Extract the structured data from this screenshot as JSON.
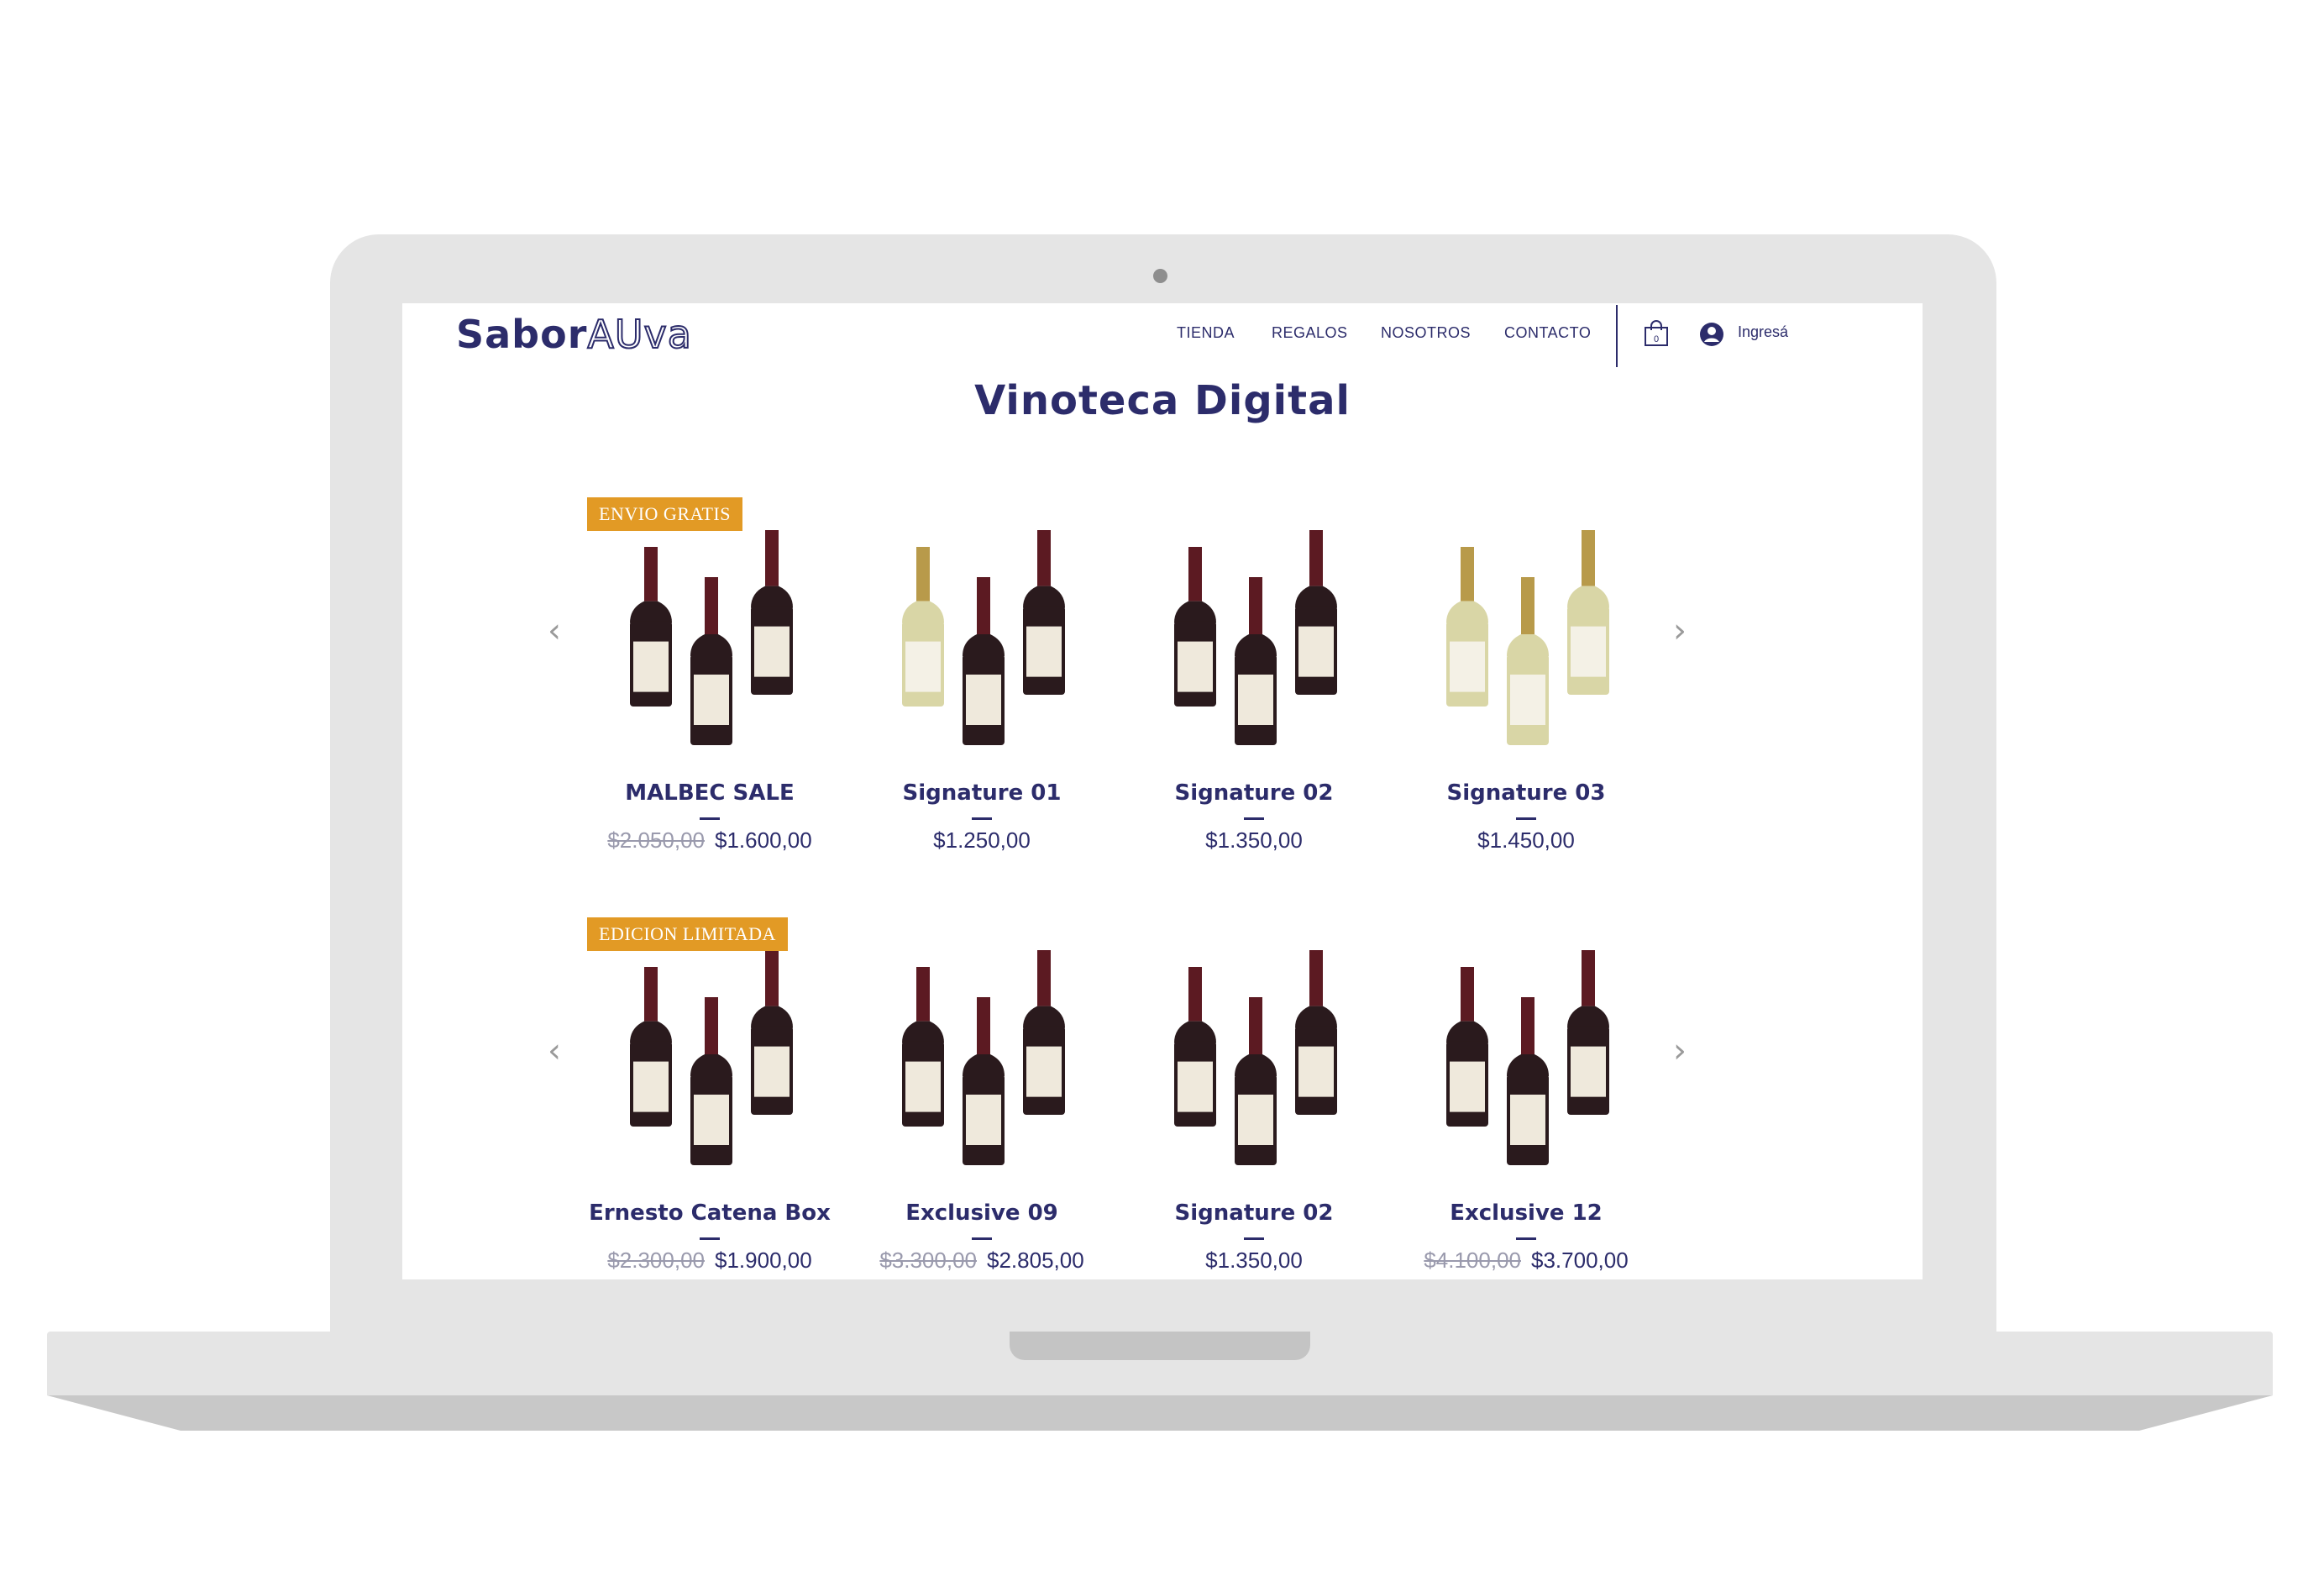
{
  "colors": {
    "brand": "#2c2c6b",
    "badge": "#e29a25",
    "old_price": "#9a9aad",
    "red_wine": "#2a1a1d",
    "white_wine": "#d9d6a6"
  },
  "header": {
    "logo_strong": "Sabor",
    "logo_outline": "AUva",
    "nav": [
      "TIENDA",
      "REGALOS",
      "NOSOTROS",
      "CONTACTO"
    ],
    "cart_count": "0",
    "login_label": "Ingresá",
    "icons": [
      "shopping-bag-icon",
      "user-circle-icon"
    ]
  },
  "page_title": "Vinoteca Digital",
  "carousel_icons": {
    "prev": "chevron-left-icon",
    "next": "chevron-right-icon"
  },
  "rows": [
    {
      "products": [
        {
          "name": "MALBEC SALE",
          "badge": "ENVIO GRATIS",
          "old_price": "$2.050,00",
          "price": "$1.600,00",
          "bottles": [
            "red",
            "red",
            "red"
          ]
        },
        {
          "name": "Signature 01",
          "badge": "",
          "old_price": "",
          "price": "$1.250,00",
          "bottles": [
            "white",
            "red",
            "red"
          ]
        },
        {
          "name": "Signature 02",
          "badge": "",
          "old_price": "",
          "price": "$1.350,00",
          "bottles": [
            "red",
            "red",
            "red"
          ]
        },
        {
          "name": "Signature 03",
          "badge": "",
          "old_price": "",
          "price": "$1.450,00",
          "bottles": [
            "white",
            "white",
            "white"
          ]
        }
      ]
    },
    {
      "products": [
        {
          "name": "Ernesto Catena Box",
          "badge": "EDICION LIMITADA",
          "old_price": "$2.300,00",
          "price": "$1.900,00",
          "bottles": [
            "red",
            "red",
            "red"
          ]
        },
        {
          "name": "Exclusive 09",
          "badge": "",
          "old_price": "$3.300,00",
          "price": "$2.805,00",
          "bottles": [
            "red",
            "red",
            "red"
          ]
        },
        {
          "name": "Signature 02",
          "badge": "",
          "old_price": "",
          "price": "$1.350,00",
          "bottles": [
            "red",
            "red",
            "red"
          ]
        },
        {
          "name": "Exclusive 12",
          "badge": "",
          "old_price": "$4.100,00",
          "price": "$3.700,00",
          "bottles": [
            "red",
            "red",
            "red"
          ]
        }
      ]
    }
  ]
}
